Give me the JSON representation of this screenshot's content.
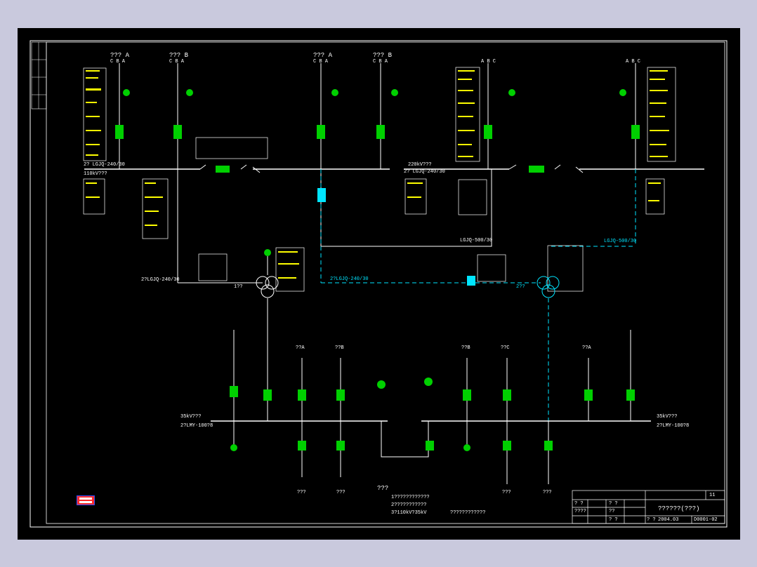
{
  "colors": {
    "background": "#c9c9dd",
    "canvas": "#000000",
    "line": "#ffffff",
    "label": "#ffff00",
    "switch": "#00e000",
    "future": "#00e5ff",
    "logo": "#ff2b2b"
  },
  "feeders_110kv": [
    "??? A",
    "??? B",
    "??? A",
    "??? B"
  ],
  "phase_labels": [
    "C B A",
    "C B A",
    "C B A",
    "C B A",
    "A B C",
    "A B C"
  ],
  "bus_110kv_left": {
    "name": "110kV???",
    "conductor": "2? LGJQ-240/30"
  },
  "bus_220kv": {
    "name": "220kV???",
    "conductor": "2? LGJQ-240/30"
  },
  "tie_line_110": "LGJQ-500/30",
  "tie_line_220_future": "LGJQ-500/30",
  "transformer_link_left": "2?LGJQ-240/30",
  "transformer_link_future": "2?LGJQ-240/30",
  "transformer_1": "1??",
  "transformer_2": "2??",
  "bus_35kv_left": {
    "name": "35kV???",
    "conductor": "2?LMY-100?8"
  },
  "bus_35kv_right": {
    "name": "35kV???",
    "conductor": "2?LMY-100?8"
  },
  "feeders_35kv_top": [
    "??A",
    "??B",
    "??B",
    "??C",
    "??A"
  ],
  "feeders_35kv_bottom": [
    "???",
    "???",
    "???",
    "???"
  ],
  "notes": {
    "heading": "???",
    "line1": "1????????????",
    "line2": "2???????????",
    "line3": "3?110kV?35kV",
    "line4": "????????????"
  },
  "title_block": {
    "drawing_title": "??????(???)",
    "sheet": "11",
    "row_cells": [
      "? ?",
      "? ?",
      "????",
      "??",
      "? ?",
      "? ?"
    ],
    "date": "2004.03",
    "number": "D0001-02"
  }
}
